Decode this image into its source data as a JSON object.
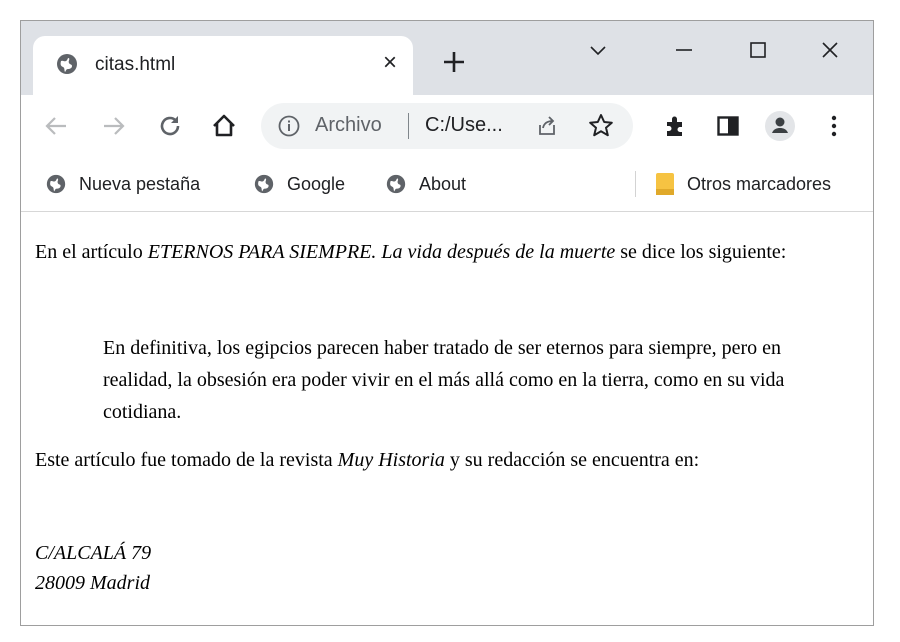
{
  "tab": {
    "title": "citas.html",
    "close_glyph": "×",
    "favicon": "globe-icon"
  },
  "window_controls": {
    "dropdown": "chevron-down-icon",
    "minimize": "minimize-icon",
    "maximize": "maximize-icon",
    "close": "close-icon"
  },
  "toolbar": {
    "scheme_label": "Archivo",
    "url": "C:/Use...",
    "icons": [
      "back-arrow-icon",
      "forward-arrow-icon",
      "reload-icon",
      "home-icon",
      "info-icon",
      "share-icon",
      "star-icon",
      "extensions-icon",
      "side-panel-icon",
      "profile-icon",
      "menu-icon"
    ]
  },
  "bookmarks": {
    "items": [
      {
        "label": "Nueva pestaña"
      },
      {
        "label": "Google"
      },
      {
        "label": "About"
      }
    ],
    "other_label": "Otros marcadores"
  },
  "page": {
    "p1_before": "En el artículo ",
    "p1_italic": "ETERNOS PARA SIEMPRE. La vida después de la muerte",
    "p1_after": " se dice los siguiente:",
    "quote": "En definitiva, los egipcios parecen haber tratado de ser eternos para siempre, pero en realidad, la obsesión era poder vivir en el más allá como en la tierra, como en su vida cotidiana.",
    "p2_before": "Este artículo fue tomado de la revista ",
    "p2_italic": "Muy Historia",
    "p2_after": " y su redacción se encuentra en:",
    "address_line1": "C/ALCALÁ 79",
    "address_line2": "28009 Madrid"
  },
  "colors": {
    "tabstrip": "#dee1e6",
    "omnibox": "#f1f3f4",
    "icon": "#5f6368",
    "folder": "#f6c342"
  }
}
